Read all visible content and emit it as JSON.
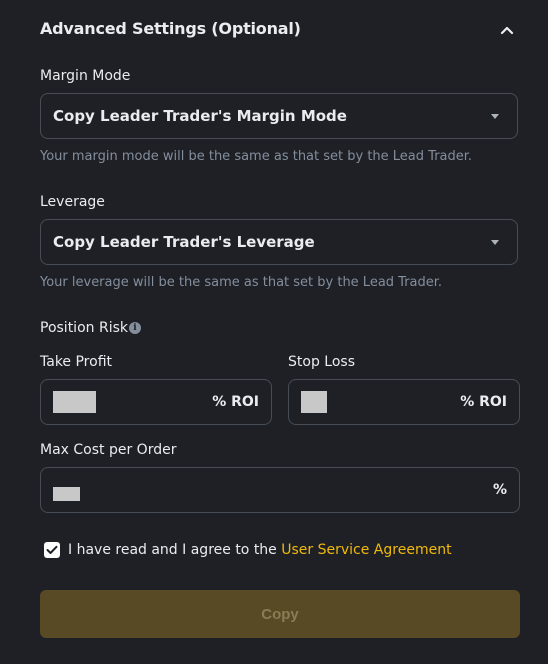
{
  "section": {
    "title": "Advanced Settings (Optional)",
    "toggle_icon": "chevron-up-icon"
  },
  "margin_mode": {
    "label": "Margin Mode",
    "value": "Copy Leader Trader's Margin Mode",
    "help": "Your margin mode will be the same as that set by the Lead Trader."
  },
  "leverage": {
    "label": "Leverage",
    "value": "Copy Leader Trader's Leverage",
    "help": "Your leverage will be the same as that set by the Lead Trader."
  },
  "position_risk": {
    "label": "Position Risk",
    "info_icon": "info-icon",
    "take_profit": {
      "label": "Take Profit",
      "unit": "% ROI"
    },
    "stop_loss": {
      "label": "Stop Loss",
      "unit": "% ROI"
    }
  },
  "max_cost": {
    "label": "Max Cost per Order",
    "unit": "%"
  },
  "agreement": {
    "checked": true,
    "text": "I have read and I agree to the ",
    "link": "User Service Agreement"
  },
  "actions": {
    "copy_label": "Copy"
  },
  "colors": {
    "accent": "#f0b90b",
    "background": "#1e2026",
    "border": "#474d57",
    "muted": "#848e9c",
    "button_disabled": "#584a24"
  }
}
